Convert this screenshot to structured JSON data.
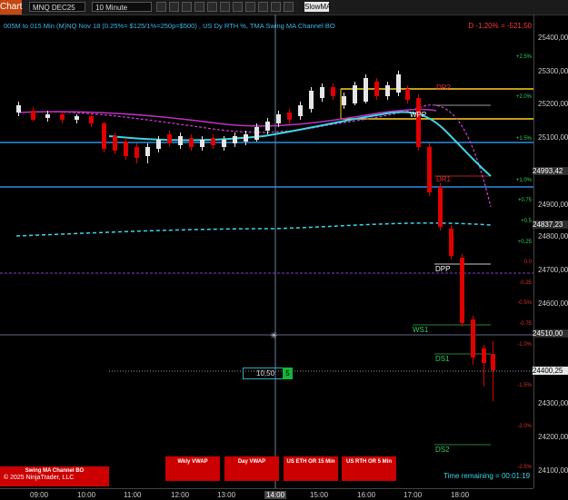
{
  "toolbar": {
    "chart_tab": "Chart",
    "instrument": "MNQ DEC25",
    "interval": "10 Minute",
    "indicator": "SlowMA"
  },
  "chart": {
    "title": "005M to 015 Min (M)NQ Nov 18 (0.25%= $125/1%=250p=$500) , US Dy RTH %, TMA Swing MA Channel BO",
    "pnl": "D -1,20% = -521,50",
    "price_ticks": [
      "25400,00",
      "25300,00",
      "25200,00",
      "25100,00",
      "24900,00",
      "24800,00",
      "24700,00",
      "24600,00",
      "24300,00",
      "24200,00",
      "24100,00"
    ],
    "price_markers": [
      {
        "label": "24993,42",
        "color": "#2f2f2f"
      },
      {
        "label": "24837,23",
        "color": "#2f2f2f"
      },
      {
        "label": "24510,00",
        "color": "#2f2f2f"
      },
      {
        "label": "24400,25",
        "color": "#e6e6e6"
      }
    ],
    "pct_labels": [
      "+2.5%",
      "+2.0%",
      "+1.5%",
      "+1.0%",
      "+0.75",
      "+0.5",
      "+0.25",
      "0.0",
      "-0.25",
      "-0.5%",
      "-0.75",
      "-1.0%",
      "-1.5%",
      "-2.0%",
      "-2.5%"
    ],
    "pivots": [
      "DR2",
      "WPP",
      "DR1",
      "DPP",
      "WS1",
      "DS1",
      "DS2"
    ],
    "time_ticks": [
      "09:00",
      "10:00",
      "11:00",
      "12:00",
      "13:00",
      "14:00",
      "15:00",
      "16:00",
      "17:00",
      "18:00"
    ],
    "qty_value": "10,50",
    "qty_green": "5"
  },
  "buttons": {
    "swing": "Swing MA Channel BO",
    "wkly_vwap": "Wkly VWAP",
    "day_vwap": "Day VWAP",
    "eth": "US ETH OR 15 Min",
    "rth": "US RTH OR 5 Min"
  },
  "footer": {
    "copyright": "© 2025 NinjaTrader, LLC",
    "remaining": "Time remaining = 00:01:19"
  },
  "colors": {
    "up": "#e6e6e6",
    "down": "#e00000",
    "blue_line": "#2a8de0",
    "teal_line": "#3cd6e6",
    "magenta": "#d040d0",
    "yellow": "#ffd020"
  }
}
